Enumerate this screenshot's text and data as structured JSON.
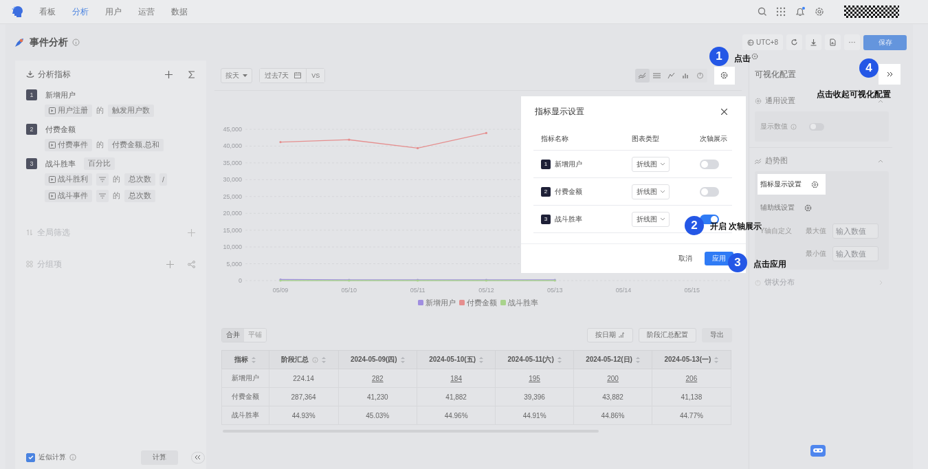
{
  "nav": {
    "tabs": [
      {
        "label": "看板",
        "selected": false
      },
      {
        "label": "分析",
        "selected": true
      },
      {
        "label": "用户",
        "selected": false
      },
      {
        "label": "运营",
        "selected": false
      },
      {
        "label": "数据",
        "selected": false
      }
    ],
    "notification": true
  },
  "page": {
    "title": "事件分析",
    "timezone": "UTC+8",
    "save": "保存"
  },
  "metrics_panel": {
    "title": "分析指标",
    "metrics": [
      {
        "index": "1",
        "name": "新增用户",
        "rows": [
          [
            {
              "kind": "event",
              "text": "用户注册"
            },
            {
              "kind": "word",
              "text": "的"
            },
            {
              "kind": "field",
              "text": "触发用户数"
            }
          ]
        ]
      },
      {
        "index": "2",
        "name": "付费金额",
        "rows": [
          [
            {
              "kind": "event",
              "text": "付费事件"
            },
            {
              "kind": "word",
              "text": "的"
            },
            {
              "kind": "field",
              "text": "付费金额.总和"
            }
          ]
        ]
      },
      {
        "index": "3",
        "name": "战斗胜率",
        "tag": "百分比",
        "rows": [
          [
            {
              "kind": "event",
              "text": "战斗胜利"
            },
            {
              "kind": "filter"
            },
            {
              "kind": "word",
              "text": "的"
            },
            {
              "kind": "field",
              "text": "总次数"
            },
            {
              "kind": "op",
              "text": "/"
            }
          ],
          [
            {
              "kind": "event",
              "text": "战斗事件"
            },
            {
              "kind": "filter"
            },
            {
              "kind": "word",
              "text": "的"
            },
            {
              "kind": "field",
              "text": "总次数"
            }
          ]
        ]
      }
    ],
    "sections": [
      {
        "label": "全局筛选",
        "kind": "filter"
      },
      {
        "label": "分组项",
        "kind": "group"
      }
    ],
    "approx": {
      "label": "近似计算",
      "checked": true
    },
    "compute": "计算"
  },
  "toolbar": {
    "granularity": "按天",
    "range": "过去7天",
    "compare": "VS",
    "chart_types": [
      {
        "selected": true
      },
      {
        "selected": false
      },
      {
        "selected": false
      },
      {
        "selected": false
      },
      {
        "selected": false
      }
    ]
  },
  "chart": {
    "chart_data": {
      "type": "line",
      "grid": true,
      "legend": true,
      "categories": [
        "05/09",
        "05/10",
        "05/11",
        "05/12",
        "05/13",
        "05/14",
        "05/15"
      ],
      "ylim": [
        0,
        45000
      ],
      "yticks": [
        {
          "value": 0,
          "label": "0"
        },
        {
          "value": 5000,
          "label": "5,000"
        },
        {
          "value": 10000,
          "label": "10,000"
        },
        {
          "value": 15000,
          "label": "15,000"
        },
        {
          "value": 20000,
          "label": "20,000"
        },
        {
          "value": 25000,
          "label": "25,000"
        },
        {
          "value": 30000,
          "label": "30,000"
        },
        {
          "value": 35000,
          "label": "35,000"
        },
        {
          "value": 40000,
          "label": "40,000"
        },
        {
          "value": 45000,
          "label": "45,000"
        }
      ],
      "series": [
        {
          "name": "新增用户",
          "color": "#a08ee0",
          "values": [
            300,
            200,
            200,
            200,
            200,
            null,
            null
          ]
        },
        {
          "name": "付费金额",
          "color": "#e58e8e",
          "values": [
            41200,
            41900,
            39400,
            43900,
            null,
            null,
            null
          ]
        },
        {
          "name": "战斗胜率",
          "color": "#a9d38c",
          "values": [
            0,
            0,
            0,
            0,
            0,
            null,
            null
          ]
        }
      ]
    }
  },
  "table_toolbar": {
    "modes": [
      {
        "label": "合并",
        "selected": true
      },
      {
        "label": "平铺",
        "selected": false
      }
    ],
    "buttons": [
      {
        "label": "按日期",
        "kind": "sort"
      },
      {
        "label": "阶段汇总配置",
        "kind": "outline"
      },
      {
        "label": "导出",
        "kind": "plain"
      }
    ]
  },
  "table": {
    "columns": [
      {
        "label": "指标",
        "info": false
      },
      {
        "label": "阶段汇总",
        "info": true
      },
      {
        "label": "2024-05-09(四)",
        "info": false
      },
      {
        "label": "2024-05-10(五)",
        "info": false
      },
      {
        "label": "2024-05-11(六)",
        "info": false
      },
      {
        "label": "2024-05-12(日)",
        "info": false
      },
      {
        "label": "2024-05-13(一)",
        "info": false
      }
    ],
    "rows": [
      {
        "linked": true,
        "cells": [
          "新增用户",
          "224.14",
          "282",
          "184",
          "195",
          "200",
          "206"
        ]
      },
      {
        "linked": false,
        "cells": [
          "付费金额",
          "287,364",
          "41,230",
          "41,882",
          "39,396",
          "43,882",
          "41,138"
        ]
      },
      {
        "linked": false,
        "cells": [
          "战斗胜率",
          "44.93%",
          "45.03%",
          "44.96%",
          "44.91%",
          "44.86%",
          "44.77%"
        ]
      }
    ]
  },
  "viz_panel": {
    "title": "可视化配置",
    "general": {
      "label": "通用设置",
      "expanded": true,
      "show_values": {
        "label": "显示数值",
        "on": false
      }
    },
    "trend": {
      "label": "趋势图",
      "expanded": true,
      "items": [
        {
          "label": "指标显示设置",
          "highlighted": true
        },
        {
          "label": "辅助线设置",
          "highlighted": false
        }
      ],
      "y_axis": {
        "label": "Y轴自定义",
        "max": {
          "label": "最大值",
          "placeholder": "输入数值"
        },
        "min": {
          "label": "最小值",
          "placeholder": "输入数值"
        }
      }
    },
    "pie": {
      "label": "饼状分布",
      "expanded": false
    }
  },
  "modal": {
    "title": "指标显示设置",
    "columns": [
      "指标名称",
      "图表类型",
      "次轴展示"
    ],
    "rows": [
      {
        "index": "1",
        "name": "新增用户",
        "chart_type": "折线图",
        "secondary_axis": false
      },
      {
        "index": "2",
        "name": "付费金额",
        "chart_type": "折线图",
        "secondary_axis": false
      },
      {
        "index": "3",
        "name": "战斗胜率",
        "chart_type": "折线图",
        "secondary_axis": true
      }
    ],
    "cancel": "取消",
    "apply": "应用"
  },
  "callouts": [
    {
      "number": "1",
      "text": "点击",
      "icon": true
    },
    {
      "number": "2",
      "text": "开启 次轴展示",
      "icon": false
    },
    {
      "number": "3",
      "text": "点击应用",
      "icon": false
    },
    {
      "number": "4",
      "text": "点击收起可视化配置",
      "icon": false
    }
  ]
}
